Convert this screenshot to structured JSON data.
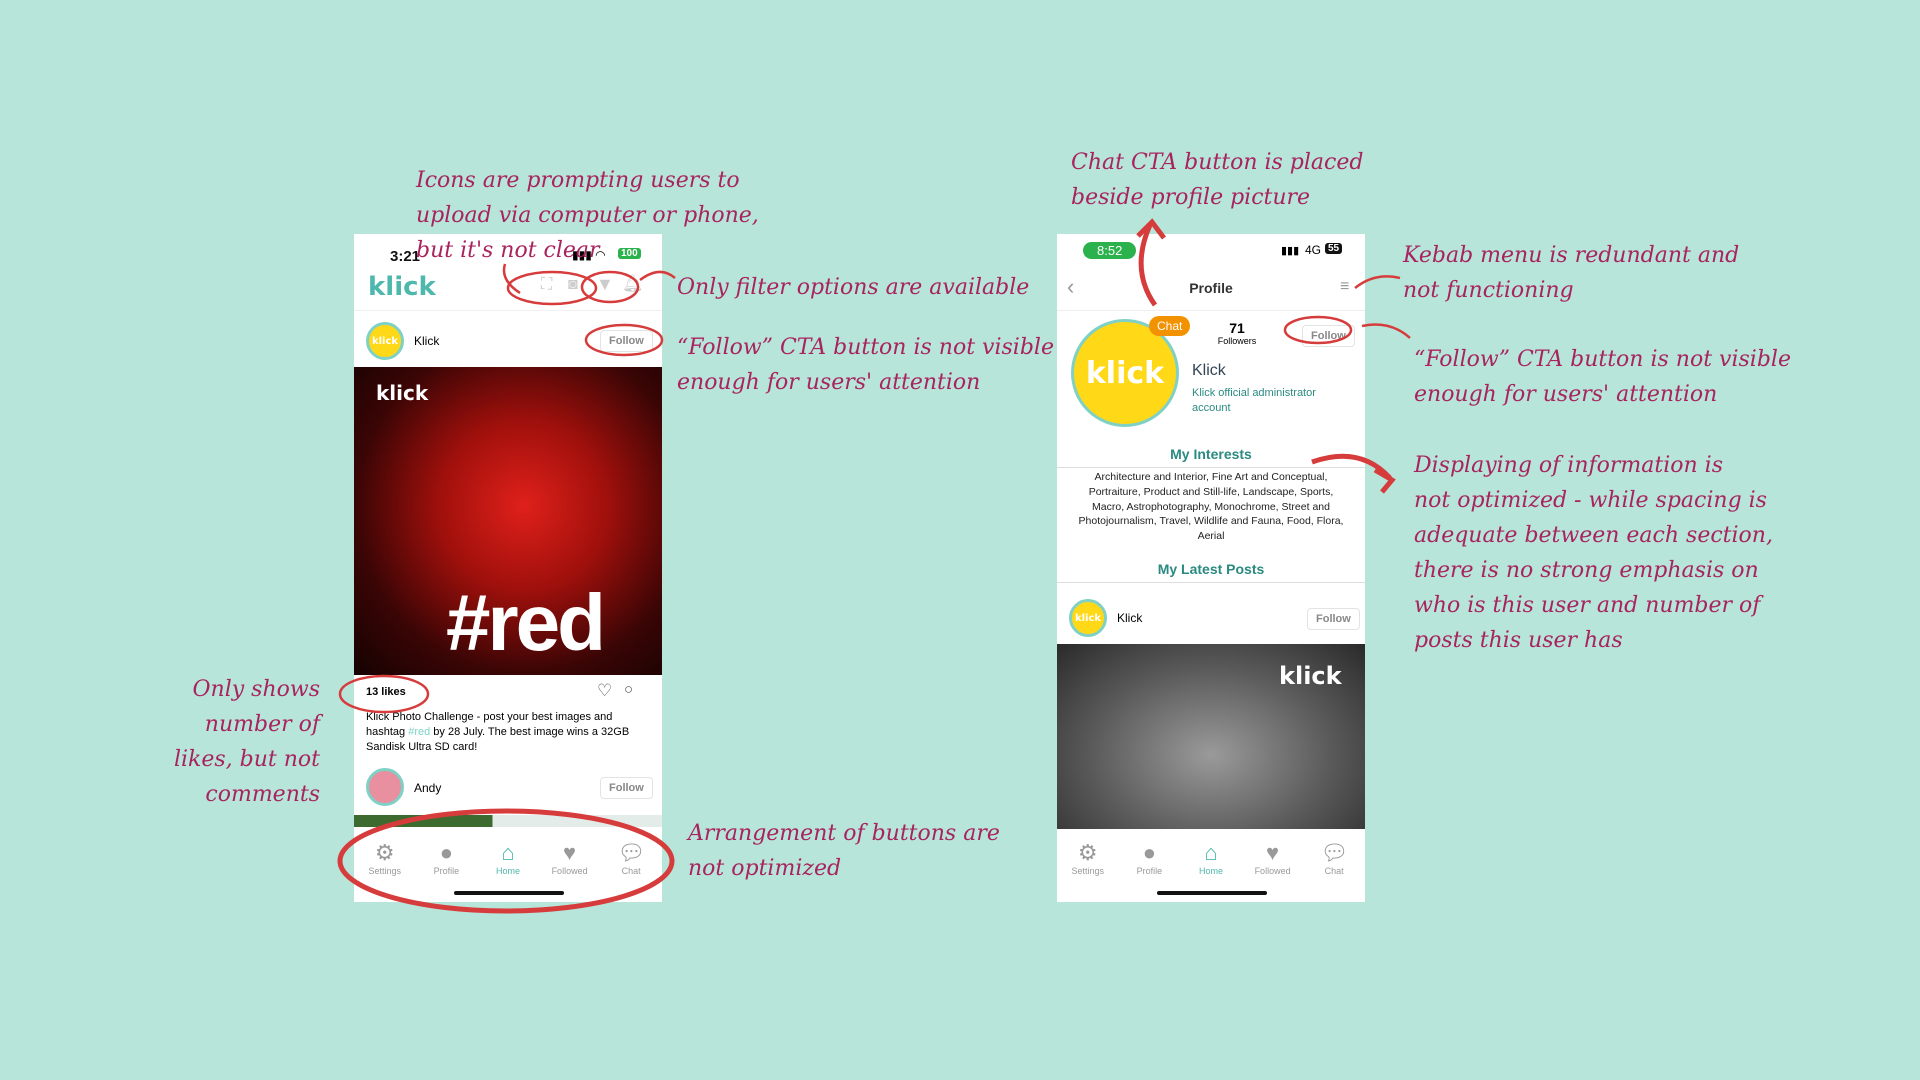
{
  "annotations": {
    "icons": [
      "Icons are prompting users to",
      "upload via computer or phone,",
      "but it's not clear"
    ],
    "filter": "Only filter options are available",
    "follow_left": [
      "“Follow” CTA button is not visible",
      "enough for users' attention"
    ],
    "likes": [
      "Only shows",
      "number of",
      "likes, but not",
      "comments"
    ],
    "arrangement": [
      "Arrangement of buttons are",
      "not optimized"
    ],
    "chat": [
      "Chat CTA button is placed",
      "beside profile picture"
    ],
    "kebab": [
      "Kebab menu is redundant and",
      "not functioning"
    ],
    "follow_right": [
      "“Follow” CTA button is not visible",
      "enough for users' attention"
    ],
    "display": [
      "Displaying of information is",
      "not optimized - while spacing is",
      "adequate between each section,",
      "there is no strong emphasis on",
      "who is this user and number of",
      "posts this user has"
    ]
  },
  "home_screen": {
    "time": "3:21",
    "battery": "100",
    "logo": "klick",
    "header_icons": [
      "scan-icon",
      "camera-icon",
      "filter-icon",
      "bell-icon"
    ],
    "post": {
      "user": "Klick",
      "follow": "Follow",
      "image_text": "#red",
      "image_logo": "klick",
      "likes": "13 likes",
      "caption_pre": "Klick Photo Challenge - post your best images and hashtag ",
      "hashtag": "#red",
      "caption_post": " by 28 July. The best image wins a 32GB Sandisk Ultra SD card!"
    },
    "next_post": {
      "user": "Andy",
      "follow": "Follow"
    }
  },
  "profile_screen": {
    "time": "8:52",
    "network": "4G",
    "battery": "55",
    "title": "Profile",
    "chat_bubble": "Chat",
    "followers_count": "71",
    "followers_label": "Followers",
    "follow": "Follow",
    "name": "Klick",
    "description": "Klick official administrator account",
    "interests_title": "My Interests",
    "interests": "Architecture and Interior, Fine Art and Conceptual, Portraiture, Product and Still-life, Landscape, Sports, Macro, Astrophotography, Monochrome, Street and Photojournalism, Travel, Wildlife and Fauna, Food, Flora, Aerial",
    "posts_title": "My Latest Posts",
    "post": {
      "user": "Klick",
      "follow": "Follow",
      "image_logo": "klick"
    }
  },
  "nav": [
    {
      "label": "Settings",
      "icon": "gear-icon"
    },
    {
      "label": "Profile",
      "icon": "person-icon"
    },
    {
      "label": "Home",
      "icon": "home-icon",
      "active": true
    },
    {
      "label": "Followed",
      "icon": "heart-icon"
    },
    {
      "label": "Chat",
      "icon": "chat-icon"
    }
  ],
  "colors": {
    "background": "#b7e5da",
    "annotation": "#a8245f",
    "accent": "#4fb8ad",
    "highlight": "#d63c3c"
  }
}
